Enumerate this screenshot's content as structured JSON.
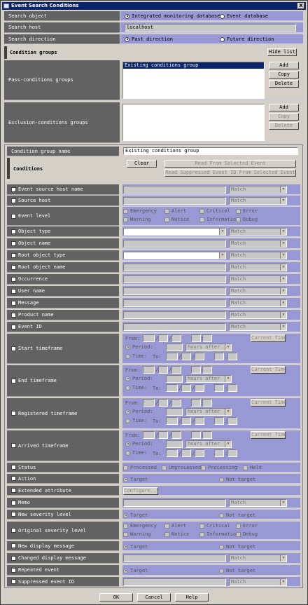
{
  "window": {
    "title": "Event Search Conditions",
    "close_glyph": "X"
  },
  "top": {
    "search_object": {
      "label": "Search object",
      "options": [
        "Integrated monitoring database",
        "Event database"
      ],
      "selected": 0
    },
    "search_host": {
      "label": "Search host",
      "value": "localhost"
    },
    "search_direction": {
      "label": "Search direction",
      "options": [
        "Past direction",
        "Future direction"
      ],
      "selected": 0
    }
  },
  "groups": {
    "title": "Condition groups",
    "hide_list": "Hide list",
    "pass": {
      "label": "Pass-conditions groups",
      "items": [
        "Existing conditions group"
      ],
      "add": "Add",
      "copy": "Copy",
      "delete": "Delete"
    },
    "excl": {
      "label": "Exclusion-conditions groups",
      "items": [],
      "add": "Add",
      "copy": "Copy",
      "delete": "Delete"
    }
  },
  "cond": {
    "group_name_label": "Condition group name",
    "group_name_value": "Existing conditions group",
    "title": "Conditions",
    "clear": "Clear",
    "read_selected": "Read From Selected Event",
    "read_suppressed": "Read Suppressed Event ID From Selected Event",
    "match": "Match",
    "from": "From:",
    "to": "To:",
    "slash": "/",
    "colon": ":",
    "period": "Period:",
    "time": "Time:",
    "hours_after": "hours after",
    "current_time": "Current Time",
    "configure": "Configure...",
    "target": "Target",
    "not_target": "Not target",
    "levels": [
      "Emergency",
      "Alert",
      "Critical",
      "Error",
      "Warning",
      "Notice",
      "Information",
      "Debug"
    ],
    "statuses": [
      "Processed",
      "Unprocessed",
      "Processing",
      "Held"
    ],
    "rows": {
      "event_source_host": "Event source host name",
      "source_host": "Source host",
      "event_level": "Event level",
      "object_type": "Object type",
      "object_name": "Object name",
      "root_object_type": "Root object type",
      "root_object_name": "Root object name",
      "occurrence": "Occurrence",
      "user_name": "User name",
      "message": "Message",
      "product_name": "Product name",
      "event_id": "Event ID",
      "start_timeframe": "Start timeframe",
      "end_timeframe": "End timeframe",
      "registered_timeframe": "Registered timeframe",
      "arrived_timeframe": "Arrived timeframe",
      "status": "Status",
      "action": "Action",
      "extended_attribute": "Extended attribute",
      "memo": "Memo",
      "new_severity": "New severity level",
      "original_severity": "Original severity level",
      "new_display_message": "New display message",
      "changed_display_message": "Changed display message",
      "repeated_event": "Repeated event",
      "suppressed_event_id": "Suppressed event ID"
    }
  },
  "footer": {
    "ok": "OK",
    "cancel": "Cancel",
    "help": "Help"
  }
}
